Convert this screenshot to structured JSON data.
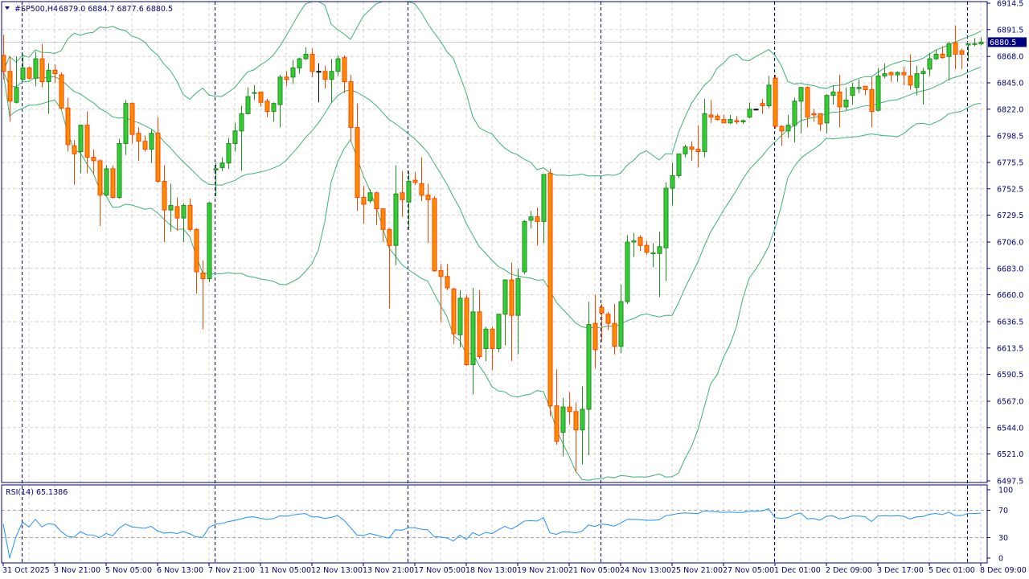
{
  "header": {
    "symbol_timeframe": "#SP500,H4",
    "ohlc": "6879.0 6884.7 6877.6 6880.5"
  },
  "rsi_label": "RSI(14) 65.1386",
  "current_price": "6880.5",
  "colors": {
    "bull": "#32CD32",
    "bull_border": "#228B22",
    "bear": "#FF8C00",
    "bear_border": "#FF4500",
    "bands": "#3CB371",
    "rsi": "#1E90FF",
    "axis": "#000080",
    "grid": "#D3D3D3"
  },
  "price_axis": [
    "6914.5",
    "6891.5",
    "6868.0",
    "6845.0",
    "6822.0",
    "6798.5",
    "6775.5",
    "6752.5",
    "6729.5",
    "6706.0",
    "6683.0",
    "6660.0",
    "6636.5",
    "6613.5",
    "6590.5",
    "6567.0",
    "6544.0",
    "6521.0",
    "6497.5"
  ],
  "rsi_axis": [
    "100",
    "70",
    "30",
    "0"
  ],
  "time_axis": [
    "31 Oct 2025",
    "3 Nov 21:00",
    "5 Nov 05:00",
    "6 Nov 13:00",
    "7 Nov 21:00",
    "11 Nov 05:00",
    "12 Nov 13:00",
    "13 Nov 21:00",
    "17 Nov 05:00",
    "18 Nov 13:00",
    "19 Nov 21:00",
    "21 Nov 05:00",
    "24 Nov 13:00",
    "25 Nov 21:00",
    "27 Nov 05:00",
    "1 Dec 01:00",
    "2 Dec 09:00",
    "3 Dec 17:00",
    "5 Dec 01:00",
    "8 Dec 09:00"
  ],
  "chart_data": {
    "type": "candlestick",
    "symbol": "#SP500",
    "timeframe": "H4",
    "ylim": [
      6497.5,
      6914.5
    ],
    "indicators": [
      "Bollinger Bands (20, 2)",
      "RSI(14)"
    ],
    "rsi_levels": [
      30,
      70
    ],
    "rsi_ylim": [
      0,
      100
    ],
    "period_separators": [
      3,
      33,
      63,
      93,
      120,
      150
    ],
    "label_every": 8,
    "ohlc": [
      [
        6869,
        6887,
        6848,
        6855
      ],
      [
        6855,
        6868,
        6811,
        6829
      ],
      [
        6828,
        6868,
        6827,
        6841
      ],
      [
        6848,
        6870,
        6847,
        6858
      ],
      [
        6858,
        6859,
        6848,
        6849
      ],
      [
        6849,
        6872,
        6842,
        6866
      ],
      [
        6866,
        6879,
        6841,
        6846
      ],
      [
        6846,
        6862,
        6818,
        6856
      ],
      [
        6856,
        6861,
        6845,
        6853
      ],
      [
        6852,
        6854,
        6822,
        6823
      ],
      [
        6823,
        6832,
        6785,
        6791
      ],
      [
        6790,
        6795,
        6756,
        6783
      ],
      [
        6785,
        6808,
        6766,
        6808
      ],
      [
        6808,
        6820,
        6766,
        6780
      ],
      [
        6780,
        6787,
        6765,
        6777
      ],
      [
        6777,
        6778,
        6720,
        6747
      ],
      [
        6747,
        6773,
        6746,
        6770
      ],
      [
        6770,
        6773,
        6744,
        6745
      ],
      [
        6745,
        6796,
        6744,
        6792
      ],
      [
        6792,
        6830,
        6782,
        6827
      ],
      [
        6827,
        6828,
        6792,
        6800
      ],
      [
        6801,
        6806,
        6777,
        6794
      ],
      [
        6794,
        6799,
        6785,
        6787
      ],
      [
        6787,
        6804,
        6775,
        6801
      ],
      [
        6801,
        6815,
        6758,
        6759
      ],
      [
        6759,
        6773,
        6706,
        6734
      ],
      [
        6734,
        6757,
        6715,
        6738
      ],
      [
        6737,
        6745,
        6716,
        6727
      ],
      [
        6727,
        6740,
        6706,
        6738
      ],
      [
        6738,
        6744,
        6715,
        6717
      ],
      [
        6717,
        6718,
        6661,
        6680
      ],
      [
        6679,
        6690,
        6630,
        6674
      ],
      [
        6674,
        6741,
        6671,
        6740
      ],
      [
        6769,
        6775,
        6746,
        6770
      ],
      [
        6771,
        6780,
        6768,
        6775
      ],
      [
        6775,
        6797,
        6770,
        6792
      ],
      [
        6792,
        6810,
        6785,
        6803
      ],
      [
        6803,
        6825,
        6768,
        6818
      ],
      [
        6818,
        6841,
        6818,
        6833
      ],
      [
        6836,
        6843,
        6830,
        6836.5
      ],
      [
        6837,
        6837,
        6824,
        6828
      ],
      [
        6829,
        6831,
        6815,
        6820
      ],
      [
        6820,
        6828,
        6811,
        6827
      ],
      [
        6826,
        6852,
        6806,
        6850
      ],
      [
        6850,
        6855,
        6842,
        6848
      ],
      [
        6850,
        6865,
        6844,
        6858
      ],
      [
        6858,
        6867,
        6853,
        6866
      ],
      [
        6866,
        6876,
        6865,
        6870
      ],
      [
        6870,
        6875,
        6850,
        6855
      ],
      [
        6855,
        6862,
        6828,
        6855
      ],
      [
        6855,
        6860,
        6840,
        6848
      ],
      [
        6848,
        6866,
        6828,
        6855
      ],
      [
        6855,
        6869,
        6851,
        6866
      ],
      [
        6867,
        6869,
        6836,
        6846
      ],
      [
        6846,
        6852,
        6794,
        6806
      ],
      [
        6806,
        6827,
        6733,
        6745
      ],
      [
        6745,
        6755,
        6722,
        6739
      ],
      [
        6742,
        6752,
        6740,
        6749
      ],
      [
        6749,
        6750,
        6721,
        6735
      ],
      [
        6735,
        6735,
        6706,
        6717
      ],
      [
        6717,
        6718,
        6648,
        6703
      ],
      [
        6703,
        6773,
        6686,
        6748
      ],
      [
        6749,
        6768,
        6728,
        6743
      ],
      [
        6741,
        6768,
        6717,
        6759
      ],
      [
        6760,
        6767,
        6756,
        6758
      ],
      [
        6757,
        6780,
        6742,
        6747
      ],
      [
        6747,
        6757,
        6705,
        6743
      ],
      [
        6744,
        6746,
        6680,
        6681
      ],
      [
        6681,
        6687,
        6636,
        6676
      ],
      [
        6676,
        6687,
        6664,
        6666
      ],
      [
        6665,
        6666,
        6617,
        6626
      ],
      [
        6625,
        6664,
        6614,
        6657
      ],
      [
        6657,
        6660,
        6598,
        6599
      ],
      [
        6599,
        6666,
        6573,
        6645
      ],
      [
        6645,
        6664,
        6604,
        6606
      ],
      [
        6613,
        6632,
        6602,
        6630
      ],
      [
        6630,
        6632,
        6594,
        6613
      ],
      [
        6613,
        6643,
        6610,
        6643
      ],
      [
        6643,
        6673,
        6616,
        6673
      ],
      [
        6673,
        6688,
        6602,
        6642
      ],
      [
        6642,
        6683,
        6608,
        6674
      ],
      [
        6680,
        6725,
        6678,
        6724
      ],
      [
        6725,
        6733,
        6718,
        6728
      ],
      [
        6728,
        6736,
        6703,
        6724
      ],
      [
        6724,
        6765,
        6705,
        6765
      ],
      [
        6766,
        6770,
        6554,
        6563
      ],
      [
        6563,
        6595,
        6529,
        6532
      ],
      [
        6540,
        6570,
        6519,
        6562
      ],
      [
        6562,
        6575,
        6547,
        6558
      ],
      [
        6558,
        6566,
        6505,
        6542
      ],
      [
        6542,
        6580,
        6512,
        6560
      ],
      [
        6560,
        6654,
        6520,
        6634
      ],
      [
        6635,
        6660,
        6596,
        6612
      ],
      [
        6649,
        6652,
        6619,
        6644
      ],
      [
        6643,
        6645,
        6629,
        6635
      ],
      [
        6635,
        6652,
        6608,
        6615
      ],
      [
        6615,
        6669,
        6609,
        6654
      ],
      [
        6654,
        6712,
        6652,
        6706
      ],
      [
        6706,
        6714,
        6693,
        6707
      ],
      [
        6710,
        6712,
        6698,
        6703
      ],
      [
        6703,
        6707,
        6695,
        6697
      ],
      [
        6696,
        6705,
        6684,
        6696.5
      ],
      [
        6696,
        6715,
        6658,
        6702
      ],
      [
        6701,
        6758,
        6672,
        6753
      ],
      [
        6753,
        6775,
        6738,
        6764
      ],
      [
        6764,
        6783,
        6762,
        6783
      ],
      [
        6783,
        6791,
        6780,
        6789
      ],
      [
        6789,
        6794,
        6777,
        6787
      ],
      [
        6787,
        6808,
        6771,
        6785
      ],
      [
        6785,
        6831,
        6780,
        6818
      ],
      [
        6817,
        6830,
        6810,
        6815
      ],
      [
        6816,
        6818,
        6812,
        6813
      ],
      [
        6813,
        6817,
        6810,
        6810
      ],
      [
        6810,
        6817,
        6809,
        6813
      ],
      [
        6812,
        6816,
        6809,
        6811
      ],
      [
        6811,
        6813,
        6809,
        6812
      ],
      [
        6815,
        6828,
        6814,
        6822
      ],
      [
        6822,
        6822,
        6822,
        6822
      ],
      [
        6827,
        6831,
        6818,
        6825
      ],
      [
        6825,
        6851,
        6823,
        6843
      ],
      [
        6849,
        6852,
        6805,
        6807
      ],
      [
        6807,
        6808,
        6790,
        6803
      ],
      [
        6803,
        6817,
        6797,
        6808
      ],
      [
        6808,
        6832,
        6793,
        6829
      ],
      [
        6829,
        6841,
        6801,
        6841
      ],
      [
        6841,
        6842,
        6806,
        6815
      ],
      [
        6818,
        6822,
        6811,
        6817
      ],
      [
        6818,
        6818,
        6803,
        6809
      ],
      [
        6810,
        6835,
        6801,
        6834
      ],
      [
        6834,
        6843,
        6826,
        6837
      ],
      [
        6837,
        6852,
        6806,
        6824
      ],
      [
        6824,
        6841,
        6821,
        6830
      ],
      [
        6834,
        6845,
        6826,
        6841
      ],
      [
        6840,
        6848,
        6836,
        6841
      ],
      [
        6842,
        6842,
        6834,
        6839
      ],
      [
        6839,
        6850,
        6806,
        6820
      ],
      [
        6821,
        6858,
        6820,
        6851
      ],
      [
        6851,
        6862,
        6849,
        6853
      ],
      [
        6854,
        6855,
        6846,
        6852
      ],
      [
        6852,
        6855,
        6846,
        6854
      ],
      [
        6854,
        6859,
        6843,
        6852
      ],
      [
        6851,
        6870,
        6839,
        6843
      ],
      [
        6841,
        6860,
        6834,
        6853
      ],
      [
        6853,
        6858,
        6826,
        6855
      ],
      [
        6857,
        6871,
        6851,
        6866
      ],
      [
        6866,
        6874,
        6865,
        6870
      ],
      [
        6870,
        6877,
        6866,
        6867
      ],
      [
        6868,
        6881,
        6847,
        6879
      ],
      [
        6880,
        6895,
        6857,
        6870
      ],
      [
        6873,
        6875,
        6857,
        6870
      ],
      [
        6878,
        6879,
        6864,
        6879
      ],
      [
        6879,
        6884,
        6877,
        6879.2
      ],
      [
        6879.0,
        6884.7,
        6877.6,
        6880.5
      ]
    ]
  }
}
